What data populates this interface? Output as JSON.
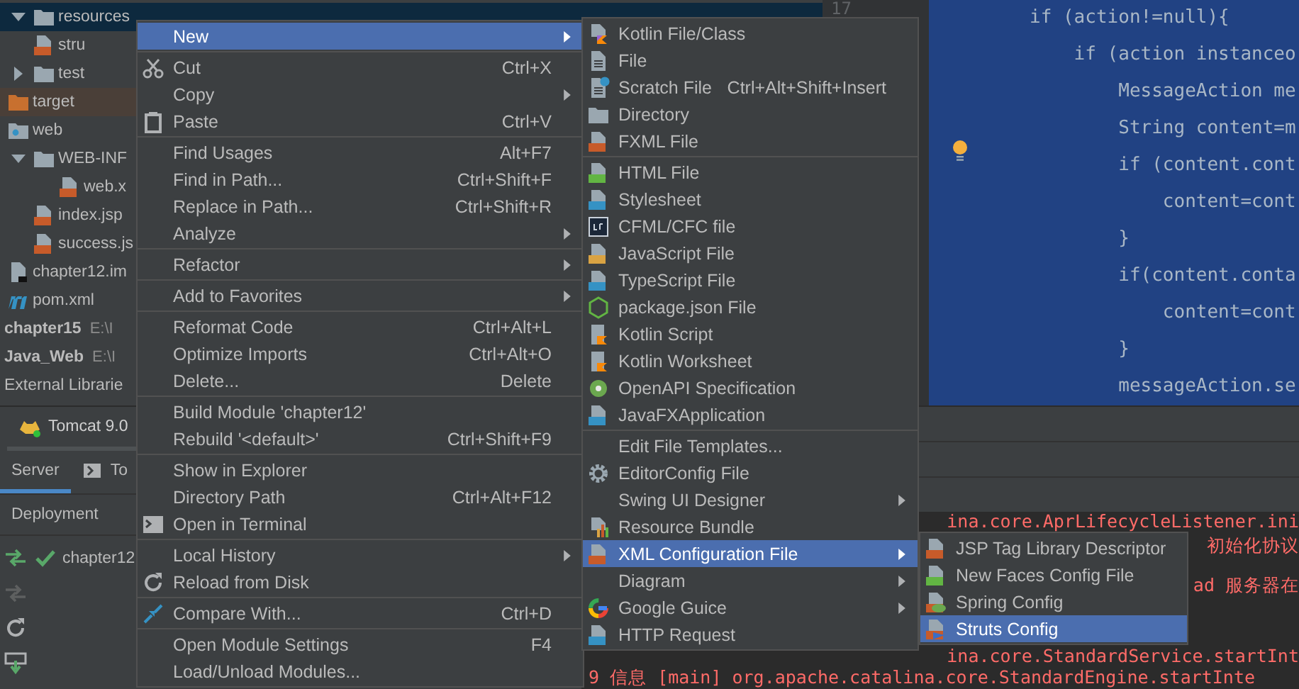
{
  "project_tree": [
    {
      "label": "resources",
      "kind": "folder",
      "expanded": true,
      "selected": true,
      "excluded": false,
      "children": [
        {
          "label": "stru",
          "kind": "xml",
          "selected": false,
          "excluded": false
        }
      ]
    },
    {
      "label": "test",
      "kind": "folder",
      "expanded": false,
      "selected": false,
      "excluded": false
    },
    {
      "label": "target",
      "kind": "folder",
      "selected": false,
      "excluded": true
    },
    {
      "label": "web",
      "kind": "web-folder",
      "selected": false,
      "excluded": false,
      "children": [
        {
          "label": "WEB-INF",
          "kind": "folder",
          "expanded": true,
          "selected": false,
          "excluded": false,
          "children": [
            {
              "label": "web.x",
              "kind": "xml",
              "selected": false,
              "excluded": false
            }
          ]
        },
        {
          "label": "index.jsp",
          "kind": "jsp",
          "selected": false,
          "excluded": false
        },
        {
          "label": "success.js",
          "kind": "jsp",
          "selected": false,
          "excluded": false
        }
      ]
    },
    {
      "label": "chapter12.im",
      "kind": "module-file",
      "selected": false,
      "excluded": false
    },
    {
      "label": "pom.xml",
      "kind": "maven",
      "selected": false,
      "excluded": false
    },
    {
      "label": "chapter15",
      "path": "E:\\I",
      "kind": "module",
      "selected": false,
      "excluded": false
    },
    {
      "label": "Java_Web",
      "path": "E:\\I",
      "kind": "module",
      "selected": false,
      "excluded": false
    },
    {
      "label": "External Librarie",
      "kind": "library",
      "selected": false,
      "excluded": false
    }
  ],
  "editor": {
    "line_numbers": [
      "17"
    ],
    "lines": [
      "if (action!=null){",
      "    if (action instanceo",
      "        MessageAction me",
      "        String content=m",
      "        if (content.cont",
      "            content=cont",
      "        }",
      "        if(content.conta",
      "            content=cont",
      "        }",
      "        messageAction.se"
    ]
  },
  "run_panel": {
    "tabs": [
      {
        "label": "Tomcat 9.0",
        "selected": true
      }
    ],
    "sub_tabs": [
      {
        "label": "Server",
        "selected": true
      },
      {
        "label": "To",
        "selected": false
      }
    ],
    "header": "Deployment",
    "toolbar": [
      {
        "disabled": false
      },
      {
        "disabled": true
      },
      {
        "disabled": false
      },
      {
        "disabled": false
      }
    ],
    "deployments": [
      {
        "label": "chapter12"
      }
    ]
  },
  "console": {
    "lines": [
      "ina.core.AprLifecycleListener.ini",
      "初始化协议",
      "ad 服务器在",
      "ina.core.StandardService.startInt",
      "9 信息 [main] org.apache.catalina.core.StandardEngine.startInte"
    ]
  },
  "context_menu": {
    "groups": [
      [
        {
          "label": "New",
          "has_submenu": true,
          "selected": true
        }
      ],
      [
        {
          "label": "Cut",
          "shortcut": "Ctrl+X",
          "has_submenu": false,
          "selected": false
        },
        {
          "label": "Copy",
          "has_submenu": true,
          "selected": false
        },
        {
          "label": "Paste",
          "shortcut": "Ctrl+V",
          "has_submenu": false,
          "selected": false
        }
      ],
      [
        {
          "label": "Find Usages",
          "shortcut": "Alt+F7",
          "has_submenu": false,
          "selected": false
        },
        {
          "label": "Find in Path...",
          "shortcut": "Ctrl+Shift+F",
          "has_submenu": false,
          "selected": false
        },
        {
          "label": "Replace in Path...",
          "shortcut": "Ctrl+Shift+R",
          "has_submenu": false,
          "selected": false
        },
        {
          "label": "Analyze",
          "has_submenu": true,
          "selected": false
        }
      ],
      [
        {
          "label": "Refactor",
          "has_submenu": true,
          "selected": false
        }
      ],
      [
        {
          "label": "Add to Favorites",
          "has_submenu": true,
          "selected": false
        }
      ],
      [
        {
          "label": "Reformat Code",
          "shortcut": "Ctrl+Alt+L",
          "has_submenu": false,
          "selected": false
        },
        {
          "label": "Optimize Imports",
          "shortcut": "Ctrl+Alt+O",
          "has_submenu": false,
          "selected": false
        },
        {
          "label": "Delete...",
          "shortcut": "Delete",
          "has_submenu": false,
          "selected": false
        }
      ],
      [
        {
          "label": "Build Module 'chapter12'",
          "has_submenu": false,
          "selected": false
        },
        {
          "label": "Rebuild '<default>'",
          "shortcut": "Ctrl+Shift+F9",
          "has_submenu": false,
          "selected": false
        }
      ],
      [
        {
          "label": "Show in Explorer",
          "has_submenu": false,
          "selected": false
        },
        {
          "label": "Directory Path",
          "shortcut": "Ctrl+Alt+F12",
          "has_submenu": false,
          "selected": false
        },
        {
          "label": "Open in Terminal",
          "has_submenu": false,
          "selected": false
        }
      ],
      [
        {
          "label": "Local History",
          "has_submenu": true,
          "selected": false
        },
        {
          "label": "Reload from Disk",
          "has_submenu": false,
          "selected": false
        }
      ],
      [
        {
          "label": "Compare With...",
          "shortcut": "Ctrl+D",
          "has_submenu": false,
          "selected": false
        }
      ],
      [
        {
          "label": "Open Module Settings",
          "shortcut": "F4",
          "has_submenu": false,
          "selected": false
        },
        {
          "label": "Load/Unload Modules...",
          "has_submenu": false,
          "selected": false
        }
      ]
    ]
  },
  "new_submenu": {
    "groups": [
      [
        {
          "label": "Kotlin File/Class",
          "has_submenu": false,
          "selected": false
        },
        {
          "label": "File",
          "has_submenu": false,
          "selected": false
        },
        {
          "label": "Scratch File",
          "shortcut": "Ctrl+Alt+Shift+Insert",
          "has_submenu": false,
          "selected": false
        },
        {
          "label": "Directory",
          "has_submenu": false,
          "selected": false
        },
        {
          "label": "FXML File",
          "has_submenu": false,
          "selected": false
        }
      ],
      [
        {
          "label": "HTML File",
          "has_submenu": false,
          "selected": false
        },
        {
          "label": "Stylesheet",
          "has_submenu": false,
          "selected": false
        },
        {
          "label": "CFML/CFC file",
          "has_submenu": false,
          "selected": false
        },
        {
          "label": "JavaScript File",
          "has_submenu": false,
          "selected": false
        },
        {
          "label": "TypeScript File",
          "has_submenu": false,
          "selected": false
        },
        {
          "label": "package.json File",
          "has_submenu": false,
          "selected": false
        },
        {
          "label": "Kotlin Script",
          "has_submenu": false,
          "selected": false
        },
        {
          "label": "Kotlin Worksheet",
          "has_submenu": false,
          "selected": false
        },
        {
          "label": "OpenAPI Specification",
          "has_submenu": false,
          "selected": false
        },
        {
          "label": "JavaFXApplication",
          "has_submenu": false,
          "selected": false
        }
      ],
      [
        {
          "label": "Edit File Templates...",
          "has_submenu": false,
          "selected": false
        },
        {
          "label": "EditorConfig File",
          "has_submenu": false,
          "selected": false
        },
        {
          "label": "Swing UI Designer",
          "has_submenu": true,
          "selected": false
        },
        {
          "label": "Resource Bundle",
          "has_submenu": false,
          "selected": false
        },
        {
          "label": "XML Configuration File",
          "has_submenu": true,
          "selected": true
        },
        {
          "label": "Diagram",
          "has_submenu": true,
          "selected": false
        },
        {
          "label": "Google Guice",
          "has_submenu": true,
          "selected": false
        },
        {
          "label": "HTTP Request",
          "has_submenu": false,
          "selected": false
        }
      ]
    ]
  },
  "xml_submenu": {
    "groups": [
      [
        {
          "label": "JSP Tag Library Descriptor",
          "has_submenu": false,
          "selected": false
        },
        {
          "label": "New Faces Config File",
          "has_submenu": false,
          "selected": false
        },
        {
          "label": "Spring Config",
          "has_submenu": false,
          "selected": false
        },
        {
          "label": "Struts Config",
          "has_submenu": false,
          "selected": true
        }
      ]
    ]
  }
}
